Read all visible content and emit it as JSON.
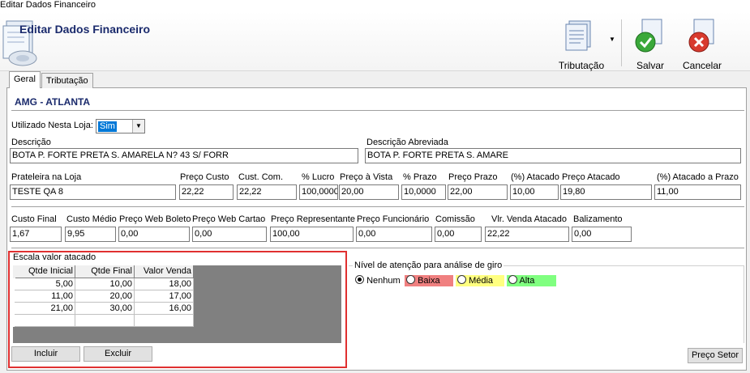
{
  "window": {
    "title": "Editar Dados Financeiro"
  },
  "header": {
    "title": "Editar Dados Financeiro"
  },
  "toolbar": {
    "tributacao_label": "Tributação",
    "salvar_label": "Salvar",
    "cancelar_label": "Cancelar"
  },
  "tabs": [
    {
      "label": "Geral"
    },
    {
      "label": "Tributação"
    }
  ],
  "store_name": "AMG - ATLANTA",
  "utilizado": {
    "label": "Utilizado Nesta Loja:",
    "value": "Sim"
  },
  "descricao": {
    "label": "Descrição",
    "value": "BOTA P. FORTE PRETA S. AMARELA N? 43 S/ FORR"
  },
  "descricao_abreviada": {
    "label": "Descrição Abreviada",
    "value": "BOTA P. FORTE PRETA S. AMARE"
  },
  "prices_row1": [
    {
      "label": "Prateleira na Loja",
      "value": "TESTE QA 8"
    },
    {
      "label": "Preço Custo",
      "value": "22,22"
    },
    {
      "label": "Cust. Com.",
      "value": "22,22"
    },
    {
      "label": "% Lucro",
      "value": "100,0000"
    },
    {
      "label": "Preço à Vista",
      "value": "20,00"
    },
    {
      "label": "% Prazo",
      "value": "10,0000"
    },
    {
      "label": "Preço Prazo",
      "value": "22,00"
    },
    {
      "label": "(%) Atacado",
      "value": "10,00"
    },
    {
      "label": "Preço Atacado",
      "value": "19,80"
    },
    {
      "label": "(%) Atacado a Prazo",
      "value": "11,00"
    }
  ],
  "prices_row2": [
    {
      "label": "Custo Final",
      "value": "1,67"
    },
    {
      "label": "Custo Médio",
      "value": "9,95"
    },
    {
      "label": "Preço Web Boleto",
      "value": "0,00"
    },
    {
      "label": "Preço Web Cartao",
      "value": "0,00"
    },
    {
      "label": "Preço Representante",
      "value": "100,00"
    },
    {
      "label": "Preço Funcionário",
      "value": "0,00"
    },
    {
      "label": "Comissão",
      "value": "0,00"
    },
    {
      "label": "Vlr. Venda Atacado",
      "value": "22,22"
    },
    {
      "label": "Balizamento",
      "value": "0,00"
    }
  ],
  "escala": {
    "title": "Escala valor atacado",
    "columns": [
      "Qtde Inicial",
      "Qtde Final",
      "Valor Venda"
    ],
    "rows": [
      [
        "5,00",
        "10,00",
        "18,00"
      ],
      [
        "11,00",
        "20,00",
        "17,00"
      ],
      [
        "21,00",
        "30,00",
        "16,00"
      ]
    ],
    "incluir_label": "Incluir",
    "excluir_label": "Excluir"
  },
  "nivel": {
    "title": "Nível de atenção para análise de giro",
    "options": [
      {
        "label": "Nenhum",
        "color": "#f0f0f0",
        "selected": true
      },
      {
        "label": "Baixa",
        "color": "#f08080",
        "selected": false
      },
      {
        "label": "Média",
        "color": "#ffff80",
        "selected": false
      },
      {
        "label": "Alta",
        "color": "#80ff80",
        "selected": false
      }
    ]
  },
  "preco_setor_label": "Preço Setor"
}
